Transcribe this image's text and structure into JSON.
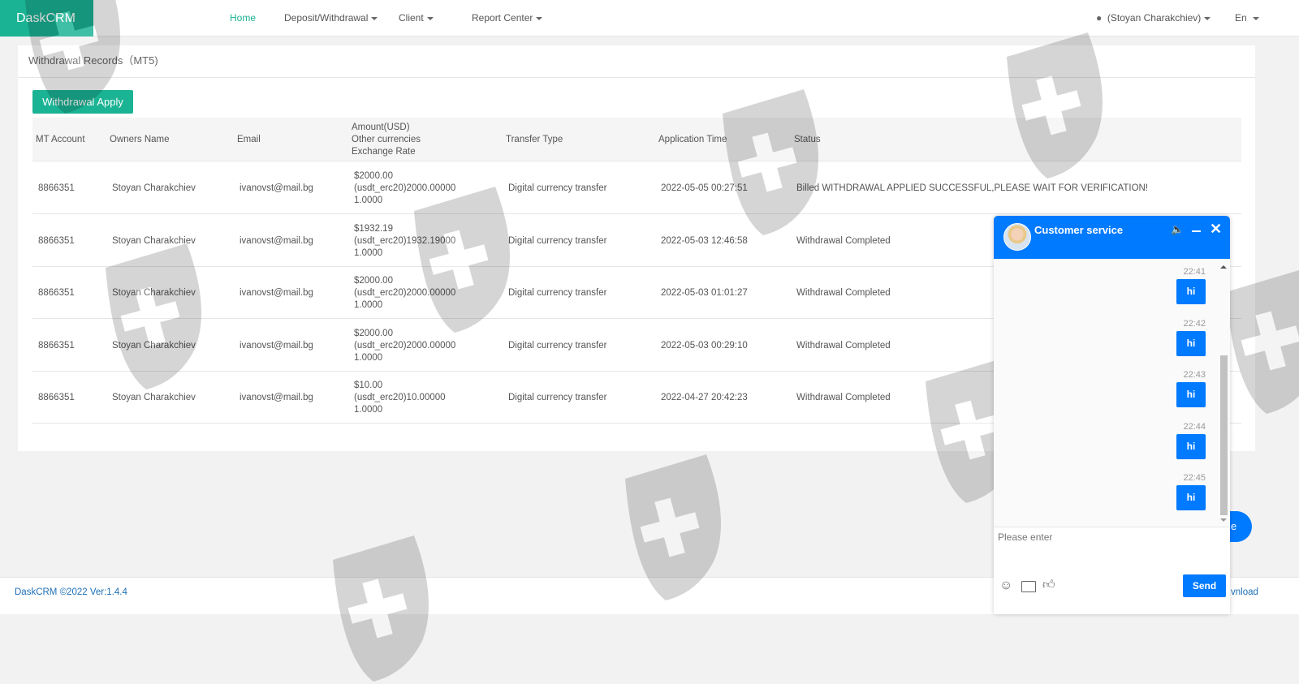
{
  "app": {
    "logo": "DaskCRM"
  },
  "nav": {
    "items": [
      {
        "label": "Home",
        "active": true
      },
      {
        "label": "Deposit/Withdrawal"
      },
      {
        "label": "Client"
      },
      {
        "label": "Report Center"
      }
    ],
    "user": "(Stoyan Charakchiev)",
    "lang": "En"
  },
  "page": {
    "title": "Withdrawal Records（MT5)",
    "apply_button": "Withdrawal Apply"
  },
  "table": {
    "headers": {
      "account": "MT Account",
      "name": "Owners Name",
      "email": "Email",
      "amount": "Amount(USD)",
      "other": "Other currencies",
      "rate": "Exchange Rate",
      "type": "Transfer Type",
      "time": "Application Time",
      "status": "Status"
    },
    "rows": [
      {
        "account": "8866351",
        "name": "Stoyan Charakchiev",
        "email": "ivanovst@mail.bg",
        "amount": "$2000.00",
        "other": "(usdt_erc20)2000.00000",
        "rate": "1.0000",
        "type": "Digital currency transfer",
        "time": "2022-05-05 00:27:51",
        "status": "Billed WITHDRAWAL APPLIED SUCCESSFUL,PLEASE WAIT FOR VERIFICATION!"
      },
      {
        "account": "8866351",
        "name": "Stoyan Charakchiev",
        "email": "ivanovst@mail.bg",
        "amount": "$1932.19",
        "other": "(usdt_erc20)1932.19000",
        "rate": "1.0000",
        "type": "Digital currency transfer",
        "time": "2022-05-03 12:46:58",
        "status": "Withdrawal Completed"
      },
      {
        "account": "8866351",
        "name": "Stoyan Charakchiev",
        "email": "ivanovst@mail.bg",
        "amount": "$2000.00",
        "other": "(usdt_erc20)2000.00000",
        "rate": "1.0000",
        "type": "Digital currency transfer",
        "time": "2022-05-03 01:01:27",
        "status": "Withdrawal Completed"
      },
      {
        "account": "8866351",
        "name": "Stoyan Charakchiev",
        "email": "ivanovst@mail.bg",
        "amount": "$2000.00",
        "other": "(usdt_erc20)2000.00000",
        "rate": "1.0000",
        "type": "Digital currency transfer",
        "time": "2022-05-03 00:29:10",
        "status": "Withdrawal Completed"
      },
      {
        "account": "8866351",
        "name": "Stoyan Charakchiev",
        "email": "ivanovst@mail.bg",
        "amount": "$10.00",
        "other": "(usdt_erc20)10.00000",
        "rate": "1.0000",
        "type": "Digital currency transfer",
        "time": "2022-04-27 20:42:23",
        "status": "Withdrawal Completed"
      }
    ]
  },
  "footer": {
    "text": "DaskCRM ©2022 Ver:1.4.4",
    "download": "vnload",
    "float_button": "e"
  },
  "chat": {
    "title": "Customer service",
    "placeholder": "Please enter",
    "send": "Send",
    "messages": [
      {
        "time": "22:41",
        "text": "hi"
      },
      {
        "time": "22:42",
        "text": "hi"
      },
      {
        "time": "22:43",
        "text": "hi"
      },
      {
        "time": "22:44",
        "text": "hi"
      },
      {
        "time": "22:45",
        "text": "hi"
      }
    ]
  }
}
